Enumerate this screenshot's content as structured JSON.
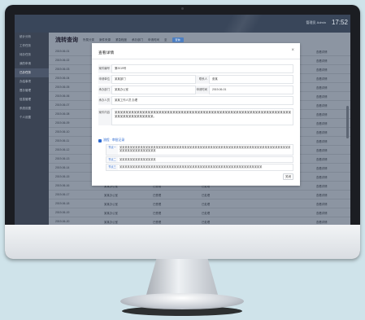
{
  "header": {
    "user": "管理员 Admin",
    "clock": "17:52"
  },
  "sidebar": {
    "items": [
      "统计分析",
      "工作任务",
      "待办任务",
      "我的申请",
      "已办任务",
      "办结事项",
      "督办管理",
      "信息管理",
      "系统设置",
      "个人设置"
    ]
  },
  "main": {
    "title": "流转查询",
    "filters": [
      "所属分类",
      "案件来源",
      "紧急程度",
      "承办部门",
      "申请时间",
      "至"
    ],
    "search_label": "查询",
    "rows": [
      [
        "2019-06-01",
        "某某办公室",
        "已受理",
        "已处理",
        "查看详情"
      ],
      [
        "2019-06-02",
        "某某办公室",
        "已受理",
        "已处理",
        "查看详情"
      ],
      [
        "2019-06-03",
        "某某办公室",
        "已受理",
        "已处理",
        "查看详情"
      ],
      [
        "2019-06-04",
        "某某办公室",
        "已受理",
        "已处理",
        "查看详情"
      ],
      [
        "2019-06-05",
        "某某办公室",
        "已受理",
        "已处理",
        "查看详情"
      ],
      [
        "2019-06-06",
        "某某办公室",
        "已受理",
        "已处理",
        "查看详情"
      ],
      [
        "2019-06-07",
        "某某办公室",
        "已受理",
        "已处理",
        "查看详情"
      ],
      [
        "2019-06-08",
        "某某办公室",
        "已受理",
        "已处理",
        "查看详情"
      ],
      [
        "2019-06-09",
        "某某办公室",
        "已受理",
        "已处理",
        "查看详情"
      ],
      [
        "2019-06-10",
        "某某办公室",
        "已受理",
        "已处理",
        "查看详情"
      ],
      [
        "2019-06-11",
        "某某办公室",
        "已受理",
        "已处理",
        "查看详情"
      ],
      [
        "2019-06-12",
        "某某办公室",
        "已受理",
        "已处理",
        "查看详情"
      ],
      [
        "2019-06-13",
        "某某办公室",
        "已受理",
        "已处理",
        "查看详情"
      ],
      [
        "2019-06-14",
        "某某办公室",
        "已受理",
        "已处理",
        "查看详情"
      ],
      [
        "2019-06-15",
        "某某办公室",
        "已受理",
        "已处理",
        "查看详情"
      ],
      [
        "2019-06-16",
        "某某办公室",
        "已受理",
        "已处理",
        "查看详情"
      ],
      [
        "2019-06-17",
        "某某办公室",
        "已受理",
        "已处理",
        "查看详情"
      ],
      [
        "2019-06-18",
        "某某办公室",
        "已受理",
        "已处理",
        "查看详情"
      ],
      [
        "2019-06-19",
        "某某办公室",
        "已受理",
        "已处理",
        "查看详情"
      ],
      [
        "2019-06-20",
        "某某办公室",
        "已受理",
        "已处理",
        "查看详情"
      ]
    ]
  },
  "modal": {
    "title": "查看详情",
    "close": "×",
    "fields": {
      "case_no_label": "案件编号",
      "case_no": "第2019号",
      "applicant_label": "申请单位",
      "applicant": "某某部门",
      "contact_label": "联系人",
      "contact": "张某",
      "dept_label": "承办部门",
      "dept": "某某办公室",
      "date_label": "申请时间",
      "date": "2019-06-01",
      "person_label": "承办人员",
      "person": "某某工作人员 办理",
      "content_label": "案件内容",
      "content": "某某某某某某某某某某某某某某某某某某某某某某某某某某某某某某某某某某某某某某某某某某某某某某某某某某某某某某某某某某某某某某某某某某某某某某某某某某某某某某。"
    },
    "process_title": "流程 · 审批记录",
    "process": [
      {
        "label": "节点一",
        "text": "某某某某某某某某某某某某某某某某某某某某某某某某某某某某某某某某某某某某某某某某某某某某某某某某某某某某某某某某某某某某某某某某某某某某某某某某某某某某某某某某"
      },
      {
        "label": "节点二",
        "text": "某某某某某某某某某某某某某某"
      },
      {
        "label": "节点三",
        "text": "某某某某某某某某某某某某某某某某某某某某某某某某某某某某某某某某某某某某某某某某某某某某某某某某某某某某某某某"
      }
    ],
    "ok_label": "关闭"
  }
}
